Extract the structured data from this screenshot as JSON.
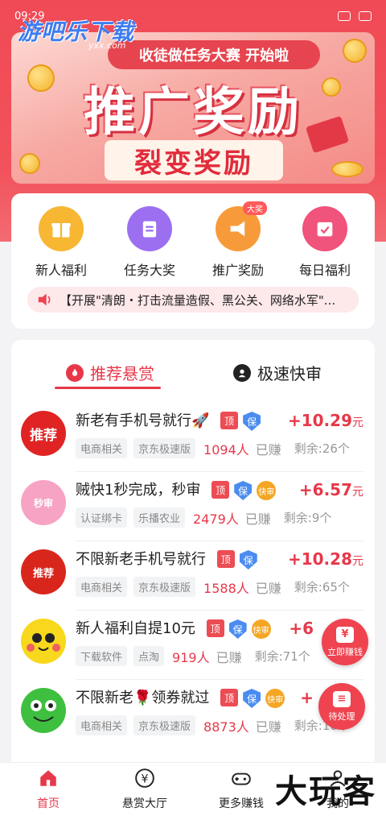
{
  "status_bar": {
    "time": "09:29"
  },
  "watermark": {
    "text": "游吧乐下载",
    "sub": "yxx.com"
  },
  "banner": {
    "tag": "收徒做任务大赛 开始啦",
    "title": "推广奖励",
    "subtitle": "裂变奖励"
  },
  "menu": {
    "items": [
      {
        "label": "新人福利",
        "icon": "gift-icon",
        "color": "#f7b733"
      },
      {
        "label": "任务大奖",
        "icon": "clipboard-icon",
        "color": "#9b6ff0"
      },
      {
        "label": "推广奖励",
        "icon": "megaphone-icon",
        "color": "#f79b3a",
        "badge": "大奖"
      },
      {
        "label": "每日福利",
        "icon": "calendar-check-icon",
        "color": "#f0537b"
      }
    ],
    "notice": "【开展\"清朗・打击流量造假、黑公关、网络水军\"..."
  },
  "tabs": {
    "active": "推荐悬赏",
    "other": "极速快审"
  },
  "tasks": [
    {
      "title": "新老有手机号就行🚀",
      "tags": [
        "顶",
        "保"
      ],
      "price": "+10.29",
      "unit": "元",
      "chips": [
        "电商相关",
        "京东极速版"
      ],
      "earned": "1094人",
      "earned_suffix": "已赚",
      "remain": "剩余:26个",
      "avatar_text": "推荐",
      "avatar_color": "#e02424"
    },
    {
      "title": "贼快1秒完成，秒审",
      "tags": [
        "顶",
        "保",
        "快审"
      ],
      "price": "+6.57",
      "unit": "元",
      "chips": [
        "认证绑卡",
        "乐播农业"
      ],
      "earned": "2479人",
      "earned_suffix": "已赚",
      "remain": "剩余:9个",
      "avatar_text": "秒审",
      "avatar_color": "#f7a3c4"
    },
    {
      "title": "不限新老手机号就行",
      "tags": [
        "顶",
        "保"
      ],
      "price": "+10.28",
      "unit": "元",
      "chips": [
        "电商相关",
        "京东极速版"
      ],
      "earned": "1588人",
      "earned_suffix": "已赚",
      "remain": "剩余:65个",
      "avatar_text": "推荐",
      "avatar_color": "#d9261c"
    },
    {
      "title": "新人福利自提10元",
      "tags": [
        "顶",
        "保",
        "快审"
      ],
      "price": "+6",
      "unit": "",
      "chips": [
        "下载软件",
        "点淘"
      ],
      "earned": "919人",
      "earned_suffix": "已赚",
      "remain": "剩余:71个",
      "avatar_text": "",
      "avatar_color": "#f8d81c"
    },
    {
      "title": "不限新老🌹领券就过",
      "tags": [
        "顶",
        "保",
        "快审"
      ],
      "price": "+",
      "unit": "",
      "chips": [
        "电商相关",
        "京东极速版"
      ],
      "earned": "8873人",
      "earned_suffix": "已赚",
      "remain": "剩余:10个",
      "avatar_text": "",
      "avatar_color": "#3fbf3f"
    }
  ],
  "float_buttons": {
    "earn": "立即赚钱",
    "pending": "待处理"
  },
  "bottom_nav": {
    "items": [
      {
        "label": "首页",
        "icon": "home-icon",
        "active": true
      },
      {
        "label": "悬赏大厅",
        "icon": "yen-icon",
        "active": false
      },
      {
        "label": "更多赚钱",
        "icon": "gamepad-icon",
        "active": false
      },
      {
        "label": "我的",
        "icon": "user-icon",
        "active": false
      }
    ]
  },
  "brand_mark": "大玩客"
}
